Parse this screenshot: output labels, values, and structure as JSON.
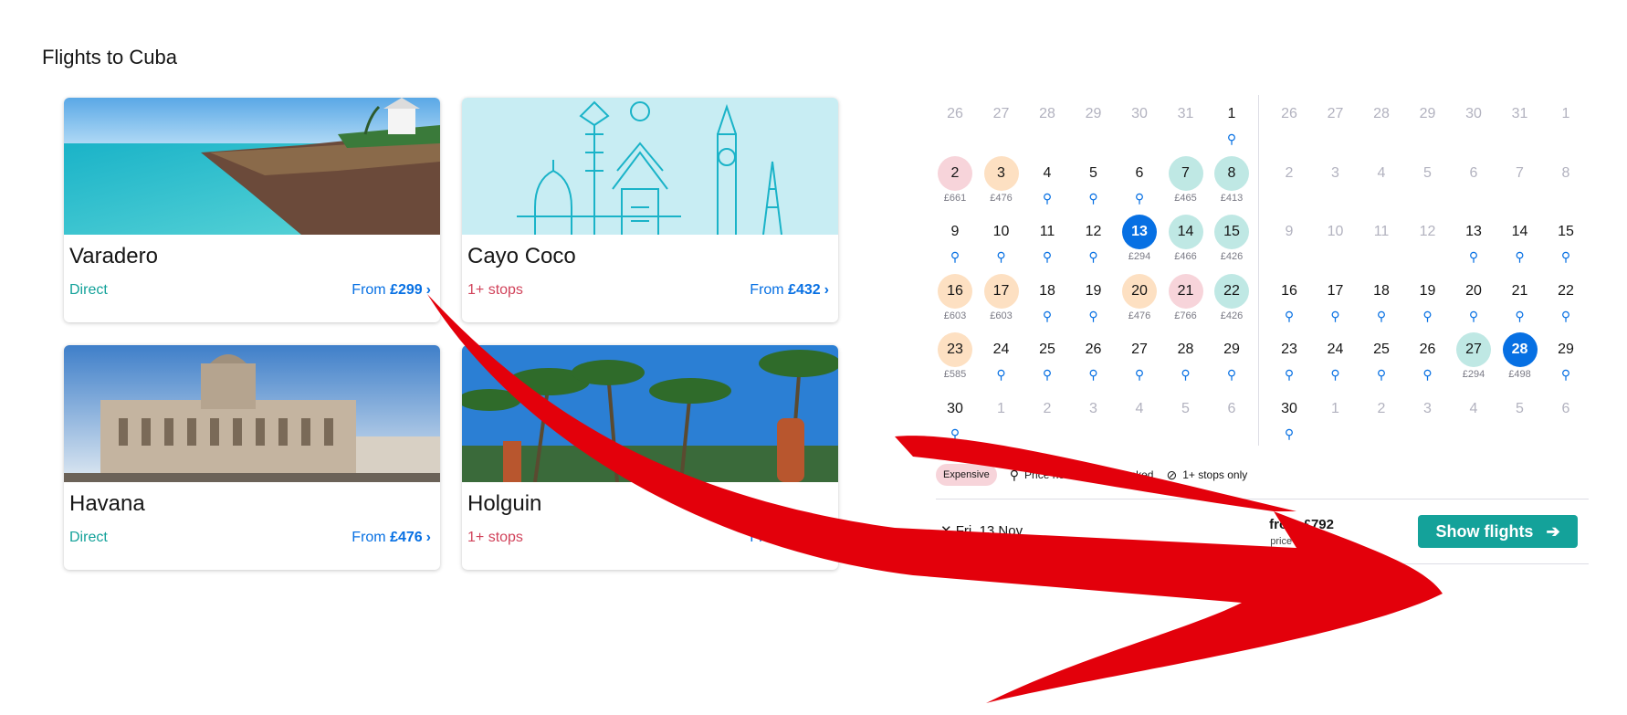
{
  "page": {
    "title": "Flights to Cuba"
  },
  "cards": [
    {
      "city": "Varadero",
      "stops": "Direct",
      "from": "From",
      "price": "£299"
    },
    {
      "city": "Cayo Coco",
      "stops": "1+ stops",
      "from": "From",
      "price": "£432"
    },
    {
      "city": "Havana",
      "stops": "Direct",
      "from": "From",
      "price": "£476"
    },
    {
      "city": "Holguin",
      "stops": "1+ stops",
      "from": "From",
      "price": "£512"
    }
  ],
  "calendar_left": {
    "rows": [
      [
        [
          "26",
          "",
          "muted",
          ""
        ],
        [
          "27",
          "",
          "muted",
          ""
        ],
        [
          "28",
          "",
          "muted",
          ""
        ],
        [
          "29",
          "",
          "muted",
          ""
        ],
        [
          "30",
          "",
          "muted",
          ""
        ],
        [
          "31",
          "",
          "muted",
          ""
        ],
        [
          "1",
          "",
          "",
          "search"
        ]
      ],
      [
        [
          "2",
          "£661",
          "exp",
          ""
        ],
        [
          "3",
          "£476",
          "mid",
          ""
        ],
        [
          "4",
          "",
          "",
          "search"
        ],
        [
          "5",
          "",
          "",
          "search"
        ],
        [
          "6",
          "",
          "",
          "search"
        ],
        [
          "7",
          "£465",
          "cheap",
          ""
        ],
        [
          "8",
          "£413",
          "cheap",
          ""
        ]
      ],
      [
        [
          "9",
          "",
          "",
          "search"
        ],
        [
          "10",
          "",
          "",
          "search"
        ],
        [
          "11",
          "",
          "",
          "search"
        ],
        [
          "12",
          "",
          "",
          "search"
        ],
        [
          "13",
          "£294",
          "sel",
          ""
        ],
        [
          "14",
          "£466",
          "cheap",
          ""
        ],
        [
          "15",
          "£426",
          "cheap",
          ""
        ]
      ],
      [
        [
          "16",
          "£603",
          "mid",
          ""
        ],
        [
          "17",
          "£603",
          "mid",
          ""
        ],
        [
          "18",
          "",
          "",
          "search"
        ],
        [
          "19",
          "",
          "",
          "search"
        ],
        [
          "20",
          "£476",
          "mid",
          ""
        ],
        [
          "21",
          "£766",
          "exp",
          ""
        ],
        [
          "22",
          "£426",
          "cheap",
          ""
        ]
      ],
      [
        [
          "23",
          "£585",
          "mid",
          ""
        ],
        [
          "24",
          "",
          "",
          "search"
        ],
        [
          "25",
          "",
          "",
          "search"
        ],
        [
          "26",
          "",
          "",
          "search"
        ],
        [
          "27",
          "",
          "",
          "search"
        ],
        [
          "28",
          "",
          "",
          "search"
        ],
        [
          "29",
          "",
          "",
          "search"
        ]
      ],
      [
        [
          "30",
          "",
          "",
          "search"
        ],
        [
          "1",
          "",
          "muted",
          ""
        ],
        [
          "2",
          "",
          "muted",
          ""
        ],
        [
          "3",
          "",
          "muted",
          ""
        ],
        [
          "4",
          "",
          "muted",
          ""
        ],
        [
          "5",
          "",
          "muted",
          ""
        ],
        [
          "6",
          "",
          "muted",
          ""
        ]
      ]
    ]
  },
  "calendar_right": {
    "rows": [
      [
        [
          "26",
          "",
          "muted",
          ""
        ],
        [
          "27",
          "",
          "muted",
          ""
        ],
        [
          "28",
          "",
          "muted",
          ""
        ],
        [
          "29",
          "",
          "muted",
          ""
        ],
        [
          "30",
          "",
          "muted",
          ""
        ],
        [
          "31",
          "",
          "muted",
          ""
        ],
        [
          "1",
          "",
          "muted",
          ""
        ]
      ],
      [
        [
          "2",
          "",
          "muted",
          ""
        ],
        [
          "3",
          "",
          "muted",
          ""
        ],
        [
          "4",
          "",
          "muted",
          ""
        ],
        [
          "5",
          "",
          "muted",
          ""
        ],
        [
          "6",
          "",
          "muted",
          ""
        ],
        [
          "7",
          "",
          "muted",
          ""
        ],
        [
          "8",
          "",
          "muted",
          ""
        ]
      ],
      [
        [
          "9",
          "",
          "muted",
          ""
        ],
        [
          "10",
          "",
          "muted",
          ""
        ],
        [
          "11",
          "",
          "muted",
          ""
        ],
        [
          "12",
          "",
          "muted",
          ""
        ],
        [
          "13",
          "",
          "",
          "search"
        ],
        [
          "14",
          "",
          "",
          "search"
        ],
        [
          "15",
          "",
          "",
          "search"
        ]
      ],
      [
        [
          "16",
          "",
          "",
          "search"
        ],
        [
          "17",
          "",
          "",
          "search"
        ],
        [
          "18",
          "",
          "",
          "search"
        ],
        [
          "19",
          "",
          "",
          "search"
        ],
        [
          "20",
          "",
          "",
          "search"
        ],
        [
          "21",
          "",
          "",
          "search"
        ],
        [
          "22",
          "",
          "",
          "search"
        ]
      ],
      [
        [
          "23",
          "",
          "",
          "search"
        ],
        [
          "24",
          "",
          "",
          "search"
        ],
        [
          "25",
          "",
          "",
          "search"
        ],
        [
          "26",
          "",
          "",
          "search"
        ],
        [
          "27",
          "£294",
          "cheap",
          ""
        ],
        [
          "28",
          "£498",
          "sel",
          ""
        ],
        [
          "29",
          "",
          "",
          "search"
        ]
      ],
      [
        [
          "30",
          "",
          "",
          "search"
        ],
        [
          "1",
          "",
          "muted",
          ""
        ],
        [
          "2",
          "",
          "muted",
          ""
        ],
        [
          "3",
          "",
          "muted",
          ""
        ],
        [
          "4",
          "",
          "muted",
          ""
        ],
        [
          "5",
          "",
          "muted",
          ""
        ],
        [
          "6",
          "",
          "muted",
          ""
        ]
      ]
    ]
  },
  "legend": {
    "expensive": "Expensive",
    "check": "Price needs to be checked",
    "stops_only": "1+ stops only"
  },
  "footer": {
    "date": "Fri, 13 Nov",
    "from_price": "from £792",
    "price_note": "price per adult",
    "show_flights": "Show flights"
  },
  "colors": {
    "accent": "#0770e3",
    "teal": "#14a29a",
    "arrow": "#e3000b"
  }
}
